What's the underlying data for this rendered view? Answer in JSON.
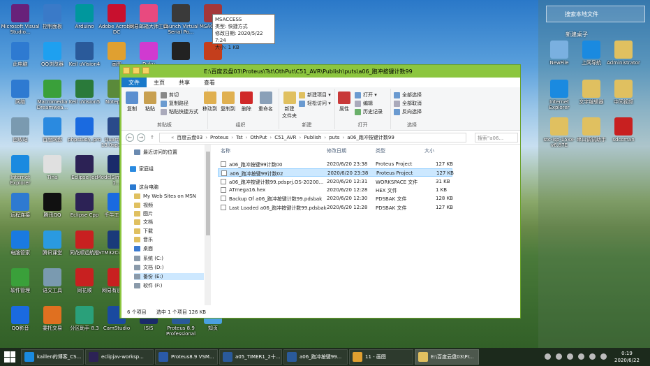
{
  "colors": {
    "window_border": "#8cc63f",
    "ribbon_tab_active": "#1979ca",
    "selection": "#cce8ff"
  },
  "desktop_icons": [
    {
      "label": "Microsoft Visual Studio...",
      "icon": "visual-studio-icon",
      "color": "#68217a"
    },
    {
      "label": "控制面板",
      "icon": "control-panel-icon",
      "color": "#3a7ac8"
    },
    {
      "label": "Arduino",
      "icon": "arduino-icon",
      "color": "#00979d"
    },
    {
      "label": "Adobe Acrobat DC",
      "icon": "acrobat-icon",
      "color": "#c8102e"
    },
    {
      "label": "网易邮箱大师工具",
      "icon": "mail-master-icon",
      "color": "#e84a7f"
    },
    {
      "label": "Launch Virtual Serial Po...",
      "icon": "virtual-serial-icon",
      "color": "#3a3a3a"
    },
    {
      "label": "MSACCESS",
      "icon": "msaccess-icon",
      "color": "#a4373a"
    },
    {
      "label": "此电脑",
      "icon": "this-pc-icon",
      "color": "#2e7ad1"
    },
    {
      "label": "QQ浏览器",
      "icon": "qq-browser-icon",
      "color": "#1ea0f0"
    },
    {
      "label": "Keil uVision4",
      "icon": "keil4-icon",
      "color": "#2a5a9a"
    },
    {
      "label": "画图",
      "icon": "paint-icon",
      "color": "#e0a030"
    },
    {
      "label": "Duku",
      "icon": "duku-icon",
      "color": "#d03ad0"
    },
    {
      "label": "",
      "icon": "app-black-icon",
      "color": "#222222"
    },
    {
      "label": "",
      "icon": "powerpoint-icon",
      "color": "#c43e1c"
    },
    {
      "label": "网络",
      "icon": "network-icon",
      "color": "#2e7ad1"
    },
    {
      "label": "Macromedia Dreamwea...",
      "icon": "dreamweaver-icon",
      "color": "#3aa03a"
    },
    {
      "label": "Keil uVision5",
      "icon": "keil5-icon",
      "color": "#2a7a3a"
    },
    {
      "label": "Notepa...",
      "icon": "notepad-icon",
      "color": "#5a8a3a"
    },
    {
      "label": "回收站",
      "icon": "recycle-bin-icon",
      "color": "#7a9ab0"
    },
    {
      "label": "百度网盘",
      "icon": "baidu-netdisk-icon",
      "color": "#2a8ae0"
    },
    {
      "label": "phpstudy_pro",
      "icon": "phpstudy-icon",
      "color": "#1a6ae0"
    },
    {
      "label": "Quartus II 13.0sp1 (6...",
      "icon": "quartus-icon",
      "color": "#2a4a8a"
    },
    {
      "label": "Internet Explorer",
      "icon": "ie-icon",
      "color": "#1a8ae0"
    },
    {
      "label": "Tina",
      "icon": "tina-icon",
      "color": "#e0e0e0"
    },
    {
      "label": "Eclipse Jee",
      "icon": "eclipse-jee-icon",
      "color": "#2c2255"
    },
    {
      "label": "ModelSim SE-64 1...",
      "icon": "modelsim-icon",
      "color": "#1a2a6a"
    },
    {
      "label": "远程连接",
      "icon": "remote-desktop-icon",
      "color": "#2e7ad1"
    },
    {
      "label": "腾讯QQ",
      "icon": "qq-icon",
      "color": "#111111"
    },
    {
      "label": "Eclipse Cpp",
      "icon": "eclipse-cpp-icon",
      "color": "#2c2255"
    },
    {
      "label": "千牛工作台",
      "icon": "qianniu-icon",
      "color": "#1a6ae0"
    },
    {
      "label": "电脑管家",
      "icon": "pc-manager-icon",
      "color": "#1a7ae0"
    },
    {
      "label": "腾讯课堂",
      "icon": "tencent-classroom-icon",
      "color": "#2a9ae0"
    },
    {
      "label": "同花顺远航版",
      "icon": "tonghuashun-yuanhang-icon",
      "color": "#c82020"
    },
    {
      "label": "STM32CubeMX",
      "icon": "stm32cubemx-icon",
      "color": "#1a3a7a"
    },
    {
      "label": "软件管理",
      "icon": "software-manager-icon",
      "color": "#3aa03a"
    },
    {
      "label": "语文工具",
      "icon": "chinese-tool-icon",
      "color": "#7a9ab0"
    },
    {
      "label": "同花顺",
      "icon": "tonghuashun-icon",
      "color": "#c82020"
    },
    {
      "label": "网易有道翻译",
      "icon": "youdao-icon",
      "color": "#c82020"
    },
    {
      "label": "QQ影音",
      "icon": "qq-player-icon",
      "color": "#1a6ae0"
    },
    {
      "label": "委托交易",
      "icon": "trade-icon",
      "color": "#e07020"
    },
    {
      "label": "分区助手 8.3",
      "icon": "partition-assistant-icon",
      "color": "#2aa07a"
    },
    {
      "label": "CamStudio",
      "icon": "camstudio-icon",
      "color": "#1a4aa0"
    },
    {
      "label": "ISIS",
      "icon": "isis-icon",
      "color": "#1a2a6a"
    },
    {
      "label": "Proteus 8.9 Professional",
      "icon": "proteus-icon",
      "color": "#2a5a9a"
    },
    {
      "label": "知页",
      "icon": "zhiye-icon",
      "color": "#4aa0e0"
    }
  ],
  "right_panel": {
    "search_label": "搜索本地文件",
    "folder_label": "新建桌子",
    "icons": [
      {
        "label": "NewFile",
        "icon": "newfile-icon",
        "color": "#7ab0e0"
      },
      {
        "label": "上网导航",
        "icon": "ie-nav-icon",
        "color": "#1a8ae0"
      },
      {
        "label": "Administrator",
        "icon": "admin-folder-icon",
        "color": "#e0c060"
      },
      {
        "label": "Internet Explorer",
        "icon": "ie-icon",
        "color": "#1a8ae0"
      },
      {
        "label": "文字编辑器",
        "icon": "folder-icon",
        "color": "#e0c060"
      },
      {
        "label": "中间视频",
        "icon": "folder-icon",
        "color": "#e0c060"
      },
      {
        "label": "stc-isp-15xx-v6.87E",
        "icon": "folder-icon",
        "color": "#e0c060"
      },
      {
        "label": "串口调试助手",
        "icon": "folder-icon",
        "color": "#e0c060"
      },
      {
        "label": "sdccman",
        "icon": "pdf-icon",
        "color": "#c82020"
      }
    ]
  },
  "tooltip": {
    "name": "MSACCESS",
    "type": "类型: 快捷方式",
    "modified": "修改日期: 2020/5/22 7:24",
    "size": "大小: 1 KB"
  },
  "explorer": {
    "title": "E:\\百度云盘03\\Proteus\\Tst\\OthPut\\C51_AVR\\Publish\\puts\\a06_跑冲按键计数99",
    "tabs": [
      "文件",
      "主页",
      "共享",
      "查看"
    ],
    "ribbon": {
      "clipboard": {
        "name": "剪贴板",
        "copy": "复制",
        "paste": "粘贴",
        "cut": "剪切",
        "copy_path": "复制路径",
        "paste_shortcut": "粘贴快捷方式"
      },
      "organize": {
        "name": "组织",
        "move_to": "移动到",
        "copy_to": "复制到",
        "delete": "删除",
        "rename": "重命名"
      },
      "new": {
        "name": "新建",
        "new_folder": "新建\n文件夹",
        "new_item": "新建项目 ▾",
        "easy_access": "轻松访问 ▾"
      },
      "open": {
        "name": "打开",
        "properties": "属性",
        "open": "打开 ▾",
        "edit": "编辑",
        "history": "历史记录"
      },
      "select": {
        "name": "选择",
        "select_all": "全部选择",
        "select_none": "全部取消",
        "invert": "反向选择"
      }
    },
    "address_crumbs": [
      "百度云盘03",
      "Proteus",
      "Tst",
      "OthPut",
      "C51_AVR",
      "Publish",
      "puts",
      "a06_跑冲按键计数99"
    ],
    "search_placeholder": "搜索\"a06...",
    "nav": [
      {
        "label": "最近访问的位置",
        "icon": "recent-icon",
        "color": "#6a8ab0"
      },
      {
        "label": "家庭组",
        "icon": "homegroup-icon",
        "color": "#2a8ae0"
      },
      {
        "label": "这台电脑",
        "icon": "this-pc-icon",
        "color": "#2a7ad1"
      },
      {
        "label": "My Web Sites on MSN",
        "icon": "folder-icon",
        "color": "#e0c060"
      },
      {
        "label": "视频",
        "icon": "videos-icon",
        "color": "#e0c060"
      },
      {
        "label": "图片",
        "icon": "pictures-icon",
        "color": "#e0c060"
      },
      {
        "label": "文档",
        "icon": "documents-icon",
        "color": "#e0c060"
      },
      {
        "label": "下载",
        "icon": "downloads-icon",
        "color": "#e0c060"
      },
      {
        "label": "音乐",
        "icon": "music-icon",
        "color": "#e0c060"
      },
      {
        "label": "桌面",
        "icon": "desktop-icon",
        "color": "#3a7ad1"
      },
      {
        "label": "系统 (C:)",
        "icon": "drive-icon",
        "color": "#8a9aaa"
      },
      {
        "label": "文档 (D:)",
        "icon": "drive-icon",
        "color": "#8a9aaa"
      },
      {
        "label": "备份 (E:)",
        "icon": "drive-icon",
        "color": "#8a9aaa"
      },
      {
        "label": "软件 (F:)",
        "icon": "drive-icon",
        "color": "#8a9aaa"
      }
    ],
    "columns": {
      "name": "名称",
      "date": "修改日期",
      "type": "类型",
      "size": "大小"
    },
    "files": [
      {
        "name": "a06_跑冲按键99计数00",
        "date": "2020/6/20 23:38",
        "type": "Proteus Project",
        "size": "127 KB"
      },
      {
        "name": "a06_跑冲按键99计数02",
        "date": "2020/6/20 23:38",
        "type": "Proteus Project",
        "size": "127 KB"
      },
      {
        "name": "a06_跑冲按键计数99.pdsprj.OS-20200...",
        "date": "2020/6/20 12:31",
        "type": "WORKSPACE 文件",
        "size": "31 KB"
      },
      {
        "name": "ATmega16.hex",
        "date": "2020/6/20 12:28",
        "type": "HEX 文件",
        "size": "1 KB"
      },
      {
        "name": "Backup Of a06_跑冲按键计数99.pdsbak",
        "date": "2020/6/20 12:30",
        "type": "PDSBAK 文件",
        "size": "128 KB"
      },
      {
        "name": "Last Loaded a06_跑冲按键计数99.pdsbak",
        "date": "2020/6/20 12:28",
        "type": "PDSBAK 文件",
        "size": "127 KB"
      }
    ],
    "status": {
      "count": "6 个项目",
      "selected": "选中 1 个项目  126 KB"
    }
  },
  "taskbar": {
    "items": [
      {
        "label": "kaillen的博客_CS...",
        "icon": "browser-icon",
        "color": "#1a8ae0"
      },
      {
        "label": "eclipjav-worksp...",
        "icon": "eclipse-icon",
        "color": "#2c2255"
      },
      {
        "label": "Proteus8.9 VSM...",
        "icon": "word-icon",
        "color": "#2a5aa8"
      },
      {
        "label": "a05_TIMER1_2十...",
        "icon": "proteus-icon",
        "color": "#2a5a9a"
      },
      {
        "label": "a06_跑冲按键99...",
        "icon": "proteus-icon",
        "color": "#2a5a9a"
      },
      {
        "label": "11 - 画图",
        "icon": "paint-icon",
        "color": "#e0a030"
      },
      {
        "label": "E:\\百度云盘03\\Pr...",
        "icon": "explorer-icon",
        "color": "#e0c060"
      }
    ],
    "time": "0:19",
    "date": "2020/6/22"
  }
}
